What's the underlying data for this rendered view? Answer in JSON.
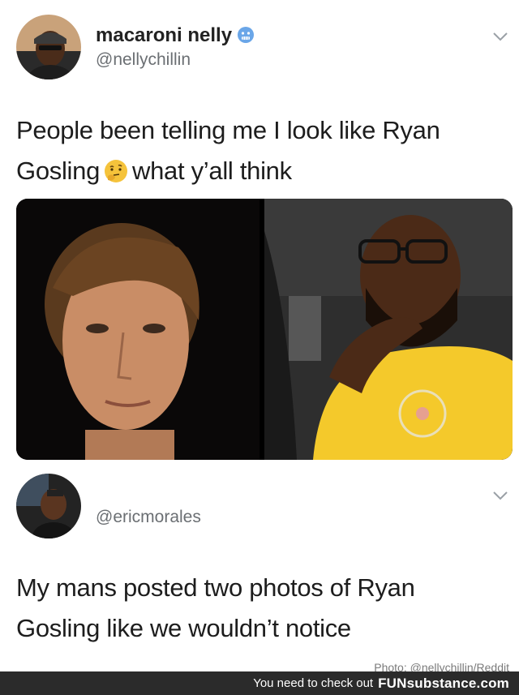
{
  "tweet1": {
    "display_name": "macaroni nelly",
    "handle": "@nellychillin",
    "text_line1": "People been telling me I look like Ryan",
    "text_line2_a": "Gosling",
    "text_line2_b": "what y’all think",
    "emoji": "thinking-face-icon"
  },
  "photos": {
    "left": "portrait-photo",
    "right": "selfie-photo"
  },
  "tweet2": {
    "handle": "@ericmorales",
    "text_line1": "My mans posted two photos of Ryan",
    "text_line2": "Gosling like we wouldn’t notice"
  },
  "credit": "Photo: @nellychillin/Reddit",
  "footer": {
    "text": "You need to check out",
    "brand": "FUNsubstance.com"
  },
  "colors": {
    "verified_badge": "#6aa6e8",
    "footer_bg": "#2b2b2b",
    "shirt": "#f4c92b"
  }
}
